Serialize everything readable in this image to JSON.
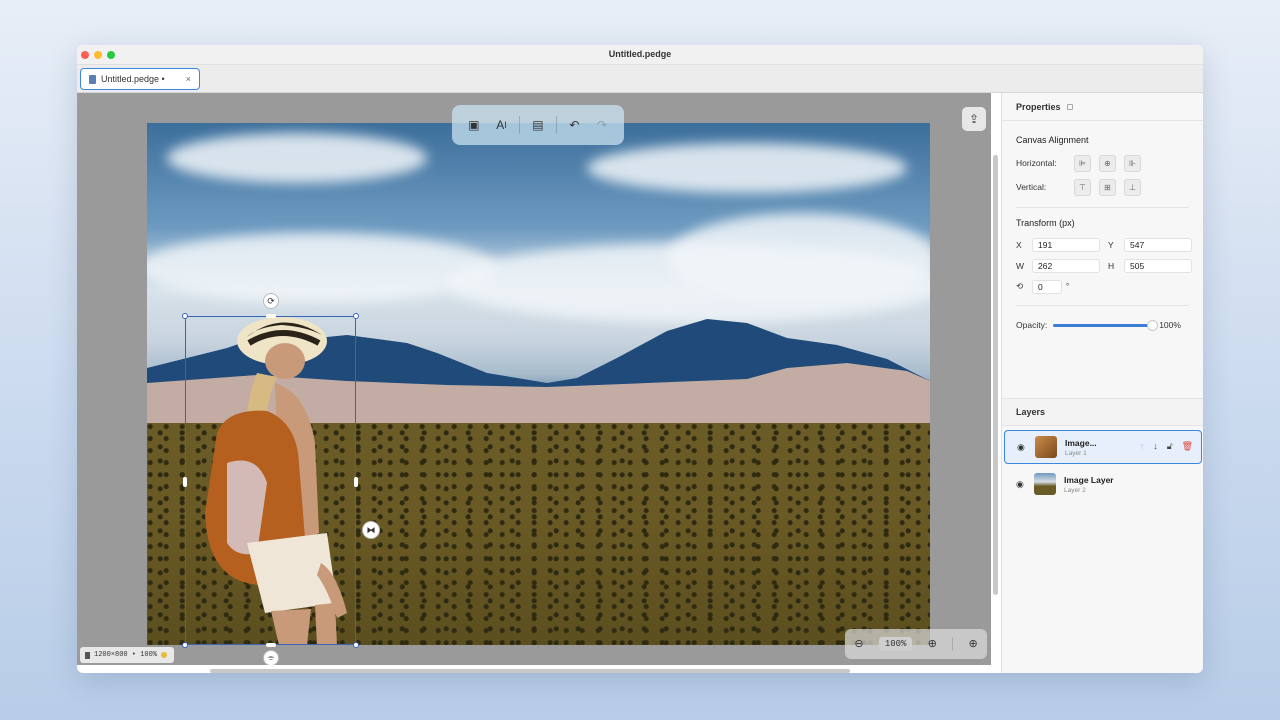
{
  "window": {
    "title": "Untitled.pedge"
  },
  "tab": {
    "label": "Untitled.pedge •",
    "close": "×"
  },
  "toolbar": {
    "add_image_icon": "add-image-icon",
    "add_text_icon": "add-text-icon",
    "layout_icon": "layout-icon",
    "undo_icon": "undo-icon",
    "redo_icon": "redo-icon"
  },
  "canvas": {
    "status": "1200×800 • 100%",
    "zoom_value": "100%",
    "zoom_out_label": "−",
    "zoom_in_label": "+"
  },
  "properties": {
    "header": "Properties",
    "canvas_alignment": "Canvas Alignment",
    "horizontal_label": "Horizontal:",
    "vertical_label": "Vertical:",
    "transform_title": "Transform (px)",
    "x_label": "X",
    "x_value": "191",
    "y_label": "Y",
    "y_value": "547",
    "w_label": "W",
    "w_value": "262",
    "h_label": "H",
    "h_value": "505",
    "rotation_value": "0",
    "rotation_unit": "°",
    "opacity_label": "Opacity:",
    "opacity_value": "100%",
    "opacity_fraction": 1.0
  },
  "layers": {
    "header": "Layers",
    "items": [
      {
        "name": "Image...",
        "sub": "Layer 1",
        "active": true
      },
      {
        "name": "Image Layer",
        "sub": "Layer 2",
        "active": false
      }
    ]
  },
  "colors": {
    "accent": "#3a86e0",
    "danger": "#e0463e",
    "selection": "#3a64b5"
  }
}
